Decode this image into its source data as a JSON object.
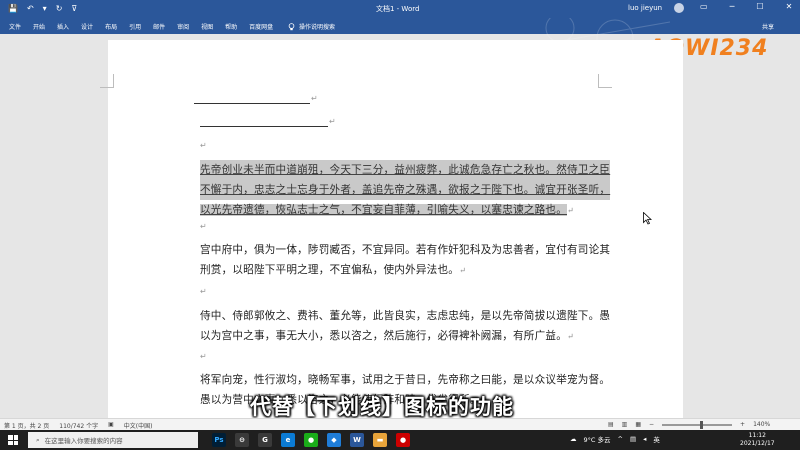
{
  "titlebar": {
    "doc_title": "文档1 - Word",
    "user": "luo jieyun",
    "qat": {
      "save": "💾",
      "undo": "↶",
      "undo_dd": "▾",
      "redo": "↻",
      "more": "⊽"
    },
    "controls": {
      "restore": "▭",
      "minimize": "─",
      "maximize": "☐",
      "close": "✕"
    }
  },
  "ribbon": {
    "tabs": [
      "文件",
      "开始",
      "插入",
      "设计",
      "布局",
      "引用",
      "邮件",
      "审阅",
      "视图",
      "帮助",
      "百度网盘"
    ],
    "tell_me": "操作说明搜索",
    "share": "共享"
  },
  "logo": {
    "text": "AOWI234"
  },
  "doc": {
    "para_mark": "↵",
    "p1": [
      "先帝创业未半而中道崩殂，今天下三分，益州疲弊，此诚危急存亡之秋也。然侍卫之臣",
      "不懈于内，忠志之士忘身于外者，盖追先帝之殊遇，欲报之于陛下也。诚宜开张圣听，",
      "以光先帝遗德，恢弘志士之气，不宜妄自菲薄，引喻失义，以塞忠谏之路也。"
    ],
    "p2": [
      "宫中府中，俱为一体，陟罚臧否，不宜异同。若有作奸犯科及为忠善者，宜付有司论其",
      "刑赏，以昭陛下平明之理，不宜偏私，使内外异法也。"
    ],
    "p3": [
      "侍中、侍郎郭攸之、费祎、董允等，此皆良实，志虑忠纯，是以先帝简拔以遗陛下。愚",
      "以为宫中之事，事无大小，悉以咨之，然后施行，必得裨补阙漏，有所广益。"
    ],
    "p4": [
      "将军向宠，性行淑均，晓畅军事，试用之于昔日，先帝称之曰能，是以众议举宠为督。",
      "愚以为营中之事，悉以咨之，必能使行阵和睦，优劣得所。"
    ]
  },
  "caption": "代替【下划线】图标的功能",
  "statusbar": {
    "page": "第 1 页，共 2 页",
    "words": "110/742 个字",
    "lang": "中文(中国)",
    "zoom": "140%",
    "zoom_minus": "−",
    "zoom_plus": "+"
  },
  "taskbar": {
    "search_placeholder": "在这里输入你要搜索的内容",
    "search_icon": "⌕",
    "apps": [
      "Ps",
      "⊖",
      "G",
      "e",
      "●",
      "◆",
      "W",
      "▬",
      "●"
    ],
    "weather": "9°C 多云",
    "ime": "英",
    "date": "2021/12/17",
    "time": "11:12"
  }
}
